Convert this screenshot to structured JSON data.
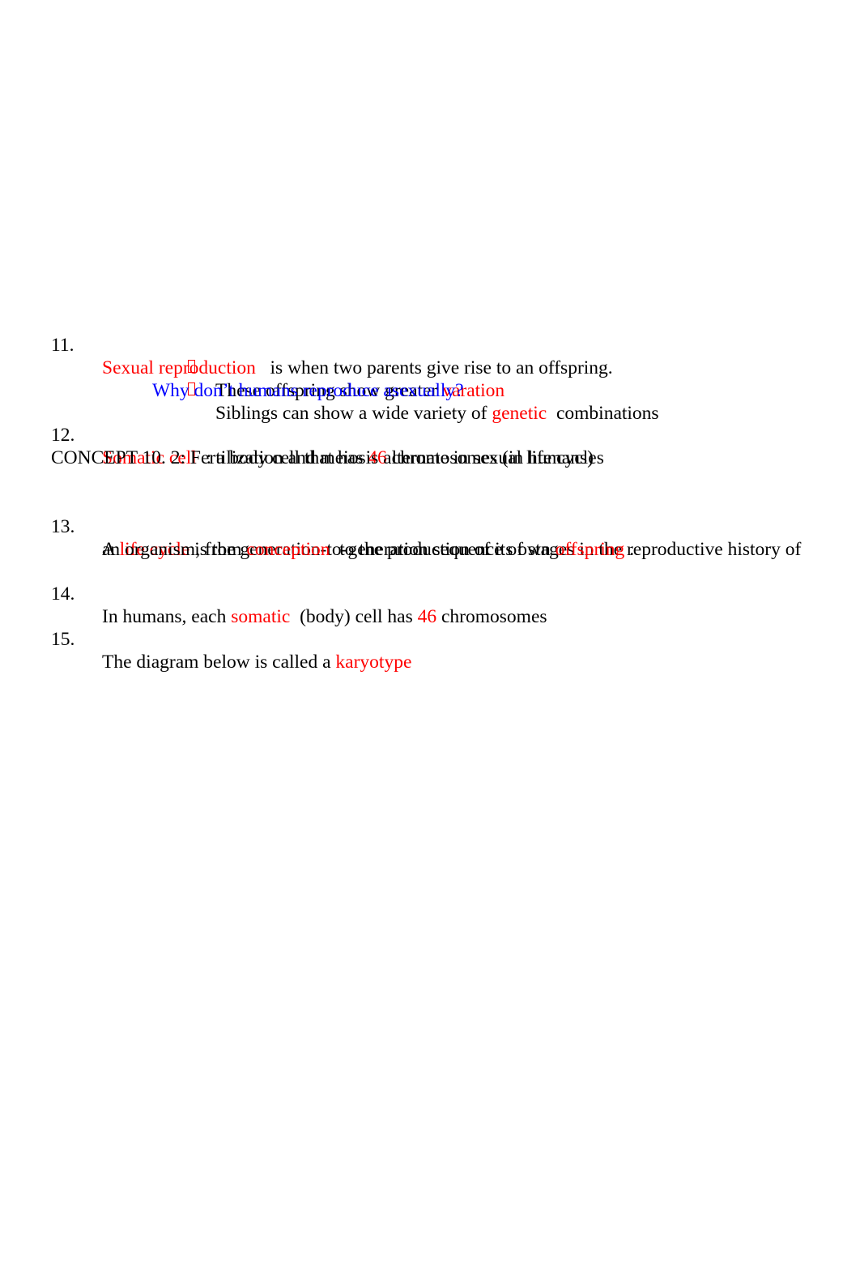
{
  "items": {
    "q11": {
      "number": "11.",
      "term": "Sexual reproduction",
      "rest": "   is when two parents give rise to an offspring.",
      "bullets": [
        {
          "pre": "These offspring show greater ",
          "red": "varation",
          "post": ""
        },
        {
          "pre": "Siblings can show a wide variety of ",
          "red": "genetic",
          "post": "  combinations"
        }
      ],
      "question": "Why don’t humans reproduce asexually?"
    },
    "q12": {
      "number": "12.",
      "term": "Somatic cell",
      "mid": "  : a body cell that has ",
      "count": "46",
      "rest": " chromosomes (in humans)"
    },
    "concept": "CONCEPT 10. 2: Fertilization and meiosis alternate in sexual life cycles",
    "q13": {
      "number": "13.",
      "pre": "A ",
      "term": "life cycle",
      "rest1": " is the generation-to-generation sequence of stages in the reproductive history of",
      "line2_pre": "an organism, from ",
      "term2": "conception",
      "line2_mid": "  to the production of its own ",
      "term3": "offspring",
      "line2_post": " ."
    },
    "q14": {
      "number": "14.",
      "pre": "In humans, each ",
      "term": "somatic",
      "mid": "  (body) cell has ",
      "count": "46",
      "post": " chromosomes"
    },
    "q15": {
      "number": "15.",
      "pre": "The diagram below is called a ",
      "term": "karyotype"
    }
  },
  "colors": {
    "answer": "#ff0000",
    "question": "#0000ff",
    "text": "#000000"
  }
}
